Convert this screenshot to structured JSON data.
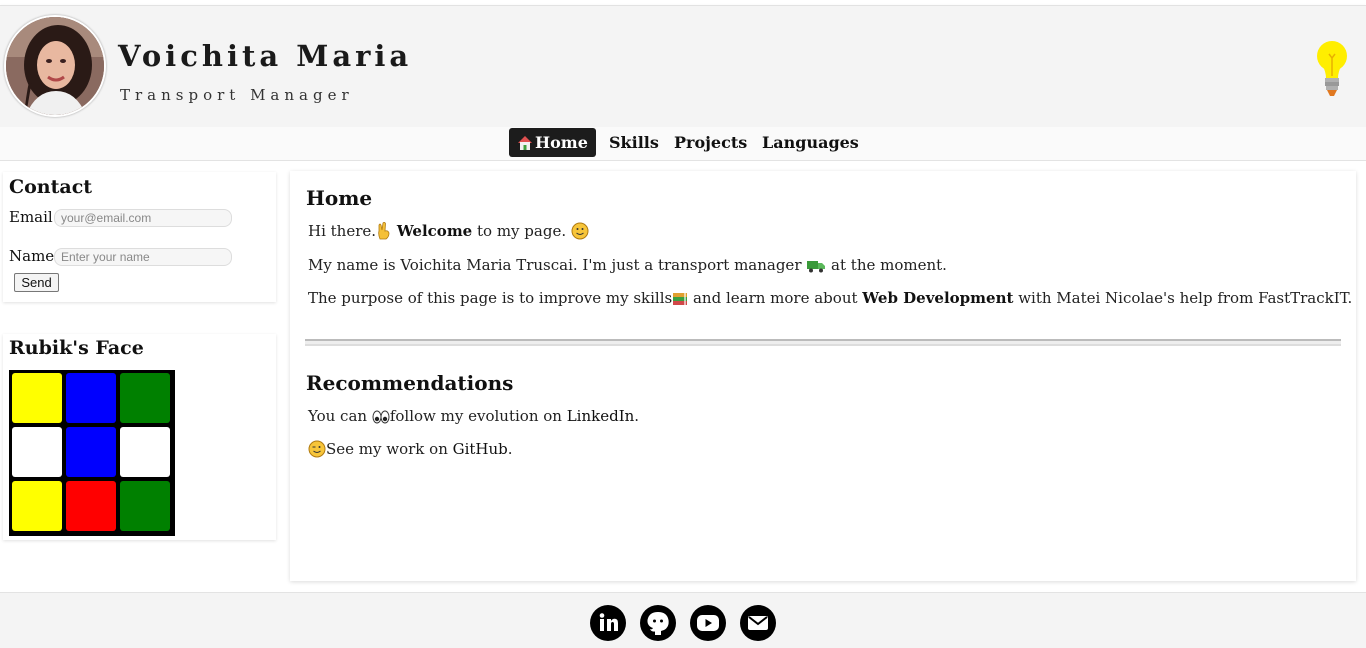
{
  "header": {
    "name": "Voichita Maria",
    "role": "Transport Manager",
    "theme_toggle_icon": "lightbulb-icon",
    "colors": {
      "bulb": "#ffee00"
    }
  },
  "nav": {
    "items": [
      {
        "label": "Home",
        "icon": "home-icon",
        "active": true
      },
      {
        "label": "Skills"
      },
      {
        "label": "Projects"
      },
      {
        "label": "Languages"
      }
    ],
    "active_bg": "#1c1c1c"
  },
  "contact": {
    "title": "Contact",
    "email_label": "Email",
    "email_placeholder": "your@email.com",
    "name_label": "Name",
    "name_placeholder": "Enter your name",
    "send_label": "Send"
  },
  "rubik": {
    "title": "Rubik's Face",
    "tiles": [
      "#ffff00",
      "#0000ff",
      "#008000",
      "#ffffff",
      "#0000ff",
      "#ffffff",
      "#ffff00",
      "#ff0000",
      "#008000"
    ]
  },
  "home": {
    "title": "Home",
    "p1": {
      "a": "Hi there.",
      "b": "Welcome",
      "c": " to my page."
    },
    "p2": {
      "a": "My name is Voichita Maria Truscai. I'm just a transport manager ",
      "b": " at the moment."
    },
    "p3": {
      "a": "The purpose of this page is to improve my skills",
      "b": " and learn more about ",
      "c": "Web Development",
      "d": " with Matei Nicolae's help from FastTrackIT."
    }
  },
  "recommendations": {
    "title": "Recommendations",
    "p1": {
      "a": "You can ",
      "b": "follow my evolution on ",
      "link": "LinkedIn",
      "c": "."
    },
    "p2": {
      "a": "See my work on ",
      "link": "GitHub",
      "c": "."
    }
  },
  "footer": {
    "icons": [
      "linkedin-icon",
      "github-icon",
      "youtube-icon",
      "email-icon"
    ]
  }
}
